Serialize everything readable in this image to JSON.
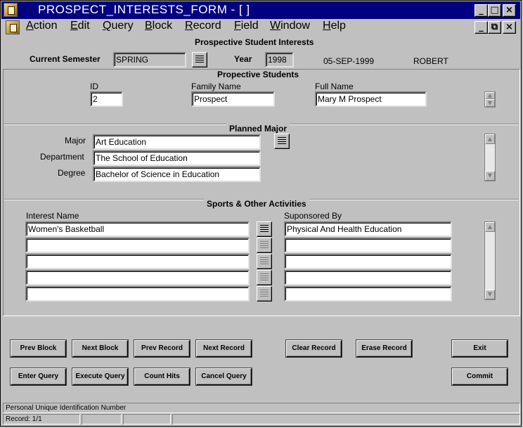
{
  "window": {
    "title": "PROSPECT_INTERESTS_FORM - [ ]",
    "min_glyph": "_",
    "max_glyph": "□",
    "close_glyph": "×",
    "restore_glyph": "⧉"
  },
  "menu": {
    "items": [
      {
        "hot": "A",
        "rest": "ction"
      },
      {
        "hot": "E",
        "rest": "dit"
      },
      {
        "hot": "Q",
        "rest": "uery"
      },
      {
        "hot": "B",
        "rest": "lock"
      },
      {
        "hot": "R",
        "rest": "ecord"
      },
      {
        "hot": "F",
        "rest": "ield"
      },
      {
        "hot": "W",
        "rest": "indow"
      },
      {
        "hot": "H",
        "rest": "elp"
      }
    ]
  },
  "header": {
    "form_title": "Prospective Student Interests",
    "semester_label": "Current Semester",
    "semester_value": "SPRING",
    "year_label": "Year",
    "year_value": "1998",
    "date": "05-SEP-1999",
    "user": "ROBERT"
  },
  "students": {
    "title": "Propective Students",
    "id_label": "ID",
    "id_value": "2",
    "family_label": "Family Name",
    "family_value": "Prospect",
    "full_label": "Full Name",
    "full_value": "Mary M Prospect"
  },
  "major": {
    "title": "Planned Major",
    "major_label": "Major",
    "major_value": "Art Education",
    "dept_label": "Department",
    "dept_value": "The School of Education",
    "degree_label": "Degree",
    "degree_value": "Bachelor of Science in Education"
  },
  "sports": {
    "title": "Sports & Other Activities",
    "col_interest": "Interest Name",
    "col_sponsor": "Suponsored By",
    "rows": [
      {
        "interest": "Women's Basketball",
        "sponsor": "Physical And Health Education"
      },
      {
        "interest": "",
        "sponsor": ""
      },
      {
        "interest": "",
        "sponsor": ""
      },
      {
        "interest": "",
        "sponsor": ""
      },
      {
        "interest": "",
        "sponsor": ""
      }
    ]
  },
  "buttons": {
    "prev_block": "Prev Block",
    "next_block": "Next Block",
    "prev_record": "Prev Record",
    "next_record": "Next Record",
    "clear_record": "Clear Record",
    "erase_record": "Erase Record",
    "exit": "Exit",
    "enter_query": "Enter Query",
    "execute_query": "Execute Query",
    "count_hits": "Count Hits",
    "cancel_query": "Cancel Query",
    "commit": "Commit"
  },
  "status": {
    "hint": "Personal Unique Identification Number",
    "record": "Record: 1/1"
  },
  "colors": {
    "title_bar": "#000080",
    "face": "#c0c0c0",
    "field": "#ffffff"
  },
  "icons": {
    "app": "oracle-forms-icon",
    "lov": "list-of-values-icon",
    "scroll_up": "scroll-up-arrow-icon",
    "scroll_down": "scroll-down-arrow-icon"
  }
}
